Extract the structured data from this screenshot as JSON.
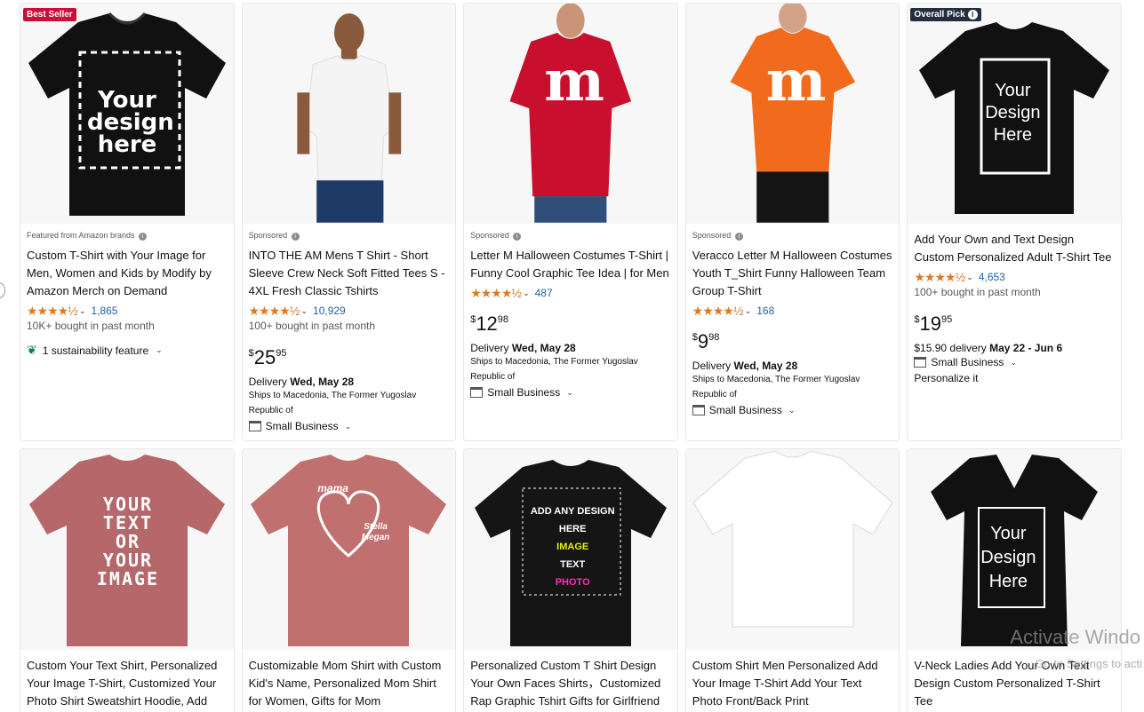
{
  "products": [
    {
      "badge": "Best Seller",
      "sponsored_label": "Featured from Amazon brands",
      "title": "Custom T-Shirt with Your Image for Men, Women and Kids by Modify by Amazon Merch on Demand",
      "stars": "★★★★½",
      "rating_count": "1,865",
      "bought": "10K+ bought in past month",
      "extra": "1 sustainability feature",
      "shirt_color": "#111111",
      "design_text": "Your design here"
    },
    {
      "sponsored_label": "Sponsored",
      "title": "INTO THE AM Mens T Shirt - Short Sleeve Crew Neck Soft Fitted Tees S - 4XL Fresh Classic Tshirts",
      "stars": "★★★★½",
      "rating_count": "10,929",
      "bought": "100+ bought in past month",
      "price_currency": "$",
      "price_whole": "25",
      "price_fraction": "95",
      "delivery_prefix": "Delivery ",
      "delivery_date": "Wed, May 28",
      "ships": "Ships to Macedonia, The Former Yugoslav Republic of",
      "small_business": "Small Business",
      "shirt_color": "#f4f4f4"
    },
    {
      "sponsored_label": "Sponsored",
      "title": "Letter M Halloween Costumes T-Shirt | Funny Cool Graphic Tee Idea | for Men",
      "stars": "★★★★½",
      "rating_count": "487",
      "price_currency": "$",
      "price_whole": "12",
      "price_fraction": "98",
      "delivery_prefix": "Delivery ",
      "delivery_date": "Wed, May 28",
      "ships": "Ships to Macedonia, The Former Yugoslav Republic of",
      "small_business": "Small Business",
      "shirt_color": "#c8102e",
      "design_text": "m"
    },
    {
      "sponsored_label": "Sponsored",
      "title": "Veracco Letter M Halloween Costumes Youth T_Shirt Funny Halloween Team Group T-Shirt",
      "stars": "★★★★½",
      "rating_count": "168",
      "price_currency": "$",
      "price_whole": "9",
      "price_fraction": "98",
      "delivery_prefix": "Delivery ",
      "delivery_date": "Wed, May 28",
      "ships": "Ships to Macedonia, The Former Yugoslav Republic of",
      "small_business": "Small Business",
      "shirt_color": "#f26b1d",
      "design_text": "m"
    },
    {
      "badge": "Overall Pick",
      "title": "Add Your Own and Text Design Custom Personalized Adult T-Shirt Tee",
      "stars": "★★★★½",
      "rating_count": "4,653",
      "bought": "100+ bought in past month",
      "price_currency": "$",
      "price_whole": "19",
      "price_fraction": "95",
      "delivery_line": "$15.90 delivery ",
      "delivery_date": "May 22 - Jun 6",
      "small_business": "Small Business",
      "extra": "Personalize it",
      "shirt_color": "#111111",
      "design_text": "Your Design Here"
    }
  ],
  "row2": [
    {
      "title": "Custom Your Text Shirt, Personalized Your Image T-Shirt, Customized Your Photo Shirt Sweatshirt Hoodie, Add",
      "shirt_color": "#b5676a",
      "design_text": "YOUR TEXT OR YOUR IMAGE"
    },
    {
      "title": "Customizable Mom Shirt with Custom Kid's Name, Personalized Mom Shirt for Women, Gifts for Mom",
      "shirt_color": "#c0706f",
      "design_text": "mama",
      "design_sub": "Stella Megan"
    },
    {
      "title": "Personalized Custom T Shirt Design Your Own Faces Shirts，Customized Rap Graphic Tshirt Gifts for Girlfriend",
      "shirt_color": "#151515",
      "design_lines": [
        "ADD ANY DESIGN",
        "HERE",
        "IMAGE",
        "TEXT",
        "PHOTO"
      ]
    },
    {
      "title": "Custom Shirt Men Personalized Add Your Image T-Shirt Add Your Text Photo Front/Back Print",
      "shirt_color": "#ffffff"
    },
    {
      "title": "V-Neck Ladies Add Your Own Text Design Custom Personalized T-Shirt Tee",
      "shirt_color": "#111111",
      "design_text": "Your Design Here"
    }
  ],
  "watermark": {
    "line1": "Activate Windo",
    "line2": "Go to Settings to acti"
  },
  "colors": {
    "best_seller": "#cc0c39",
    "overall_pick": "#232f3e",
    "star": "#de7921",
    "link": "#2162a1"
  }
}
